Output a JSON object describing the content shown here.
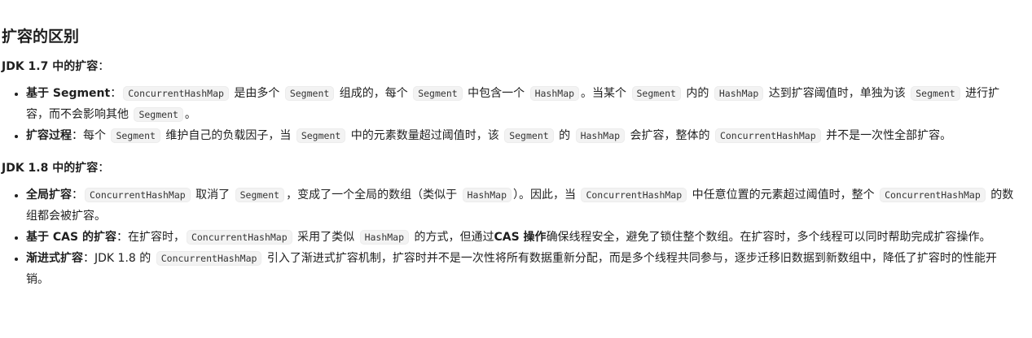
{
  "heading": "扩容的区别",
  "jdk17": {
    "title_bold": "JDK 1.7 中的扩容",
    "title_colon": "：",
    "item1": {
      "bold": "基于 Segment",
      "colon": "：",
      "c1": "ConcurrentHashMap",
      "t1": " 是由多个 ",
      "c2": "Segment",
      "t2": " 组成的，每个 ",
      "c3": "Segment",
      "t3": " 中包含一个 ",
      "c4": "HashMap",
      "t4": "。当某个 ",
      "c5": "Segment",
      "t5": " 内的 ",
      "c6": "HashMap",
      "t6": " 达到扩容阈值时，单独为该 ",
      "c7": "Segment",
      "t7": " 进行扩容，而不会影响其他 ",
      "c8": "Segment",
      "t8": "。"
    },
    "item2": {
      "bold": "扩容过程",
      "colon": "：",
      "t0": "每个 ",
      "c1": "Segment",
      "t1": " 维护自己的负载因子，当 ",
      "c2": "Segment",
      "t2": " 中的元素数量超过阈值时，该 ",
      "c3": "Segment",
      "t3": " 的 ",
      "c4": "HashMap",
      "t4": " 会扩容，整体的 ",
      "c5": "ConcurrentHashMap",
      "t5": " 并不是一次性全部扩容。"
    }
  },
  "jdk18": {
    "title_bold": "JDK 1.8 中的扩容",
    "title_colon": "：",
    "item1": {
      "bold": "全局扩容",
      "colon": "：",
      "c1": "ConcurrentHashMap",
      "t1": " 取消了 ",
      "c2": "Segment",
      "t2": "，变成了一个全局的数组（类似于 ",
      "c3": "HashMap",
      "t3": "）。因此，当 ",
      "c4": "ConcurrentHashMap",
      "t4": " 中任意位置的元素超过阈值时，整个 ",
      "c5": "ConcurrentHashMap",
      "t5": " 的数组都会被扩容。"
    },
    "item2": {
      "bold": "基于 CAS 的扩容",
      "colon": "：",
      "t0": "在扩容时，",
      "c1": "ConcurrentHashMap",
      "t1": " 采用了类似 ",
      "c2": "HashMap",
      "t2": " 的方式，但通过",
      "b2": "CAS 操作",
      "t3": "确保线程安全，避免了锁住整个数组。在扩容时，多个线程可以同时帮助完成扩容操作。"
    },
    "item3": {
      "bold": "渐进式扩容",
      "colon": "：",
      "t0": "JDK 1.8 的 ",
      "c1": "ConcurrentHashMap",
      "t1": " 引入了渐进式扩容机制，扩容时并不是一次性将所有数据重新分配，而是多个线程共同参与，逐步迁移旧数据到新数组中，降低了扩容时的性能开销。"
    }
  }
}
